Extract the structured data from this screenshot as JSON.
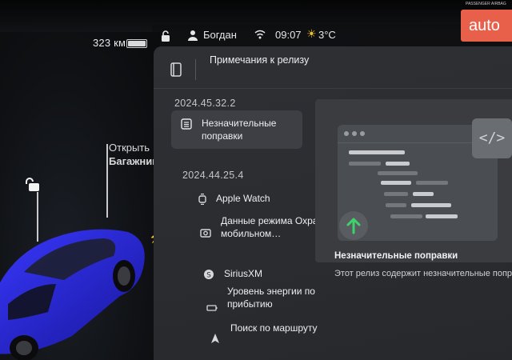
{
  "status": {
    "range": "323 км",
    "battery_level": 0.9,
    "driver": "Богдан",
    "time": "09:07",
    "temperature": "3°C"
  },
  "car_panel": {
    "trunk_label_line1": "Открыть",
    "trunk_label_line2": "Багажник",
    "car_color": "#2b2ad6"
  },
  "header": {
    "title": "Примечания к релизу"
  },
  "releases": [
    {
      "version": "2024.45.32.2",
      "items": [
        {
          "label": "Незначительные поправки",
          "icon": "list-icon",
          "selected": true
        }
      ]
    },
    {
      "version": "2024.44.25.4",
      "items": [
        {
          "label": "Apple Watch",
          "icon": "watch-icon"
        },
        {
          "label": "Данные режима Охрана в мобильном…",
          "icon": "camera-icon"
        },
        {
          "label": "SiriusXM",
          "icon": "sirius-icon"
        },
        {
          "label": "Уровень энергии по прибытию",
          "icon": "battery-icon"
        },
        {
          "label": "Поиск по маршруту",
          "icon": "navigate-icon"
        }
      ]
    }
  ],
  "detail": {
    "title": "Незначительные поправки",
    "body": "Этот релиз содержит незначительные поправки и улучше"
  },
  "colors": {
    "accent_green": "#3fd16b",
    "panel_bg": "#2c2e32",
    "selected_bg": "#3d3f44",
    "logo_bg": "#e9604a"
  },
  "watermark": {
    "logo_text": "auto",
    "small_text": "PASSENGER AIRBAG"
  }
}
